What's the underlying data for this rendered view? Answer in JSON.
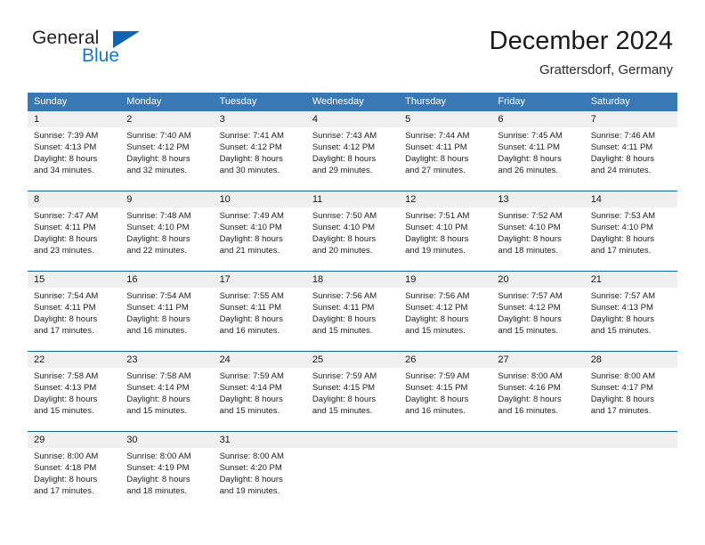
{
  "brand": {
    "name_part1": "General",
    "name_part2": "Blue",
    "triangle_color": "#1263ad"
  },
  "header": {
    "title": "December 2024",
    "subtitle": "Grattersdorf, Germany"
  },
  "theme": {
    "header_bg": "#3878b4",
    "week_divider": "#1263ad",
    "daynum_band": "#efefef"
  },
  "weekdays": [
    "Sunday",
    "Monday",
    "Tuesday",
    "Wednesday",
    "Thursday",
    "Friday",
    "Saturday"
  ],
  "weeks": [
    {
      "days": [
        {
          "num": "1",
          "sunrise": "Sunrise: 7:39 AM",
          "sunset": "Sunset: 4:13 PM",
          "daylight1": "Daylight: 8 hours",
          "daylight2": "and 34 minutes."
        },
        {
          "num": "2",
          "sunrise": "Sunrise: 7:40 AM",
          "sunset": "Sunset: 4:12 PM",
          "daylight1": "Daylight: 8 hours",
          "daylight2": "and 32 minutes."
        },
        {
          "num": "3",
          "sunrise": "Sunrise: 7:41 AM",
          "sunset": "Sunset: 4:12 PM",
          "daylight1": "Daylight: 8 hours",
          "daylight2": "and 30 minutes."
        },
        {
          "num": "4",
          "sunrise": "Sunrise: 7:43 AM",
          "sunset": "Sunset: 4:12 PM",
          "daylight1": "Daylight: 8 hours",
          "daylight2": "and 29 minutes."
        },
        {
          "num": "5",
          "sunrise": "Sunrise: 7:44 AM",
          "sunset": "Sunset: 4:11 PM",
          "daylight1": "Daylight: 8 hours",
          "daylight2": "and 27 minutes."
        },
        {
          "num": "6",
          "sunrise": "Sunrise: 7:45 AM",
          "sunset": "Sunset: 4:11 PM",
          "daylight1": "Daylight: 8 hours",
          "daylight2": "and 26 minutes."
        },
        {
          "num": "7",
          "sunrise": "Sunrise: 7:46 AM",
          "sunset": "Sunset: 4:11 PM",
          "daylight1": "Daylight: 8 hours",
          "daylight2": "and 24 minutes."
        }
      ]
    },
    {
      "days": [
        {
          "num": "8",
          "sunrise": "Sunrise: 7:47 AM",
          "sunset": "Sunset: 4:11 PM",
          "daylight1": "Daylight: 8 hours",
          "daylight2": "and 23 minutes."
        },
        {
          "num": "9",
          "sunrise": "Sunrise: 7:48 AM",
          "sunset": "Sunset: 4:10 PM",
          "daylight1": "Daylight: 8 hours",
          "daylight2": "and 22 minutes."
        },
        {
          "num": "10",
          "sunrise": "Sunrise: 7:49 AM",
          "sunset": "Sunset: 4:10 PM",
          "daylight1": "Daylight: 8 hours",
          "daylight2": "and 21 minutes."
        },
        {
          "num": "11",
          "sunrise": "Sunrise: 7:50 AM",
          "sunset": "Sunset: 4:10 PM",
          "daylight1": "Daylight: 8 hours",
          "daylight2": "and 20 minutes."
        },
        {
          "num": "12",
          "sunrise": "Sunrise: 7:51 AM",
          "sunset": "Sunset: 4:10 PM",
          "daylight1": "Daylight: 8 hours",
          "daylight2": "and 19 minutes."
        },
        {
          "num": "13",
          "sunrise": "Sunrise: 7:52 AM",
          "sunset": "Sunset: 4:10 PM",
          "daylight1": "Daylight: 8 hours",
          "daylight2": "and 18 minutes."
        },
        {
          "num": "14",
          "sunrise": "Sunrise: 7:53 AM",
          "sunset": "Sunset: 4:10 PM",
          "daylight1": "Daylight: 8 hours",
          "daylight2": "and 17 minutes."
        }
      ]
    },
    {
      "days": [
        {
          "num": "15",
          "sunrise": "Sunrise: 7:54 AM",
          "sunset": "Sunset: 4:11 PM",
          "daylight1": "Daylight: 8 hours",
          "daylight2": "and 17 minutes."
        },
        {
          "num": "16",
          "sunrise": "Sunrise: 7:54 AM",
          "sunset": "Sunset: 4:11 PM",
          "daylight1": "Daylight: 8 hours",
          "daylight2": "and 16 minutes."
        },
        {
          "num": "17",
          "sunrise": "Sunrise: 7:55 AM",
          "sunset": "Sunset: 4:11 PM",
          "daylight1": "Daylight: 8 hours",
          "daylight2": "and 16 minutes."
        },
        {
          "num": "18",
          "sunrise": "Sunrise: 7:56 AM",
          "sunset": "Sunset: 4:11 PM",
          "daylight1": "Daylight: 8 hours",
          "daylight2": "and 15 minutes."
        },
        {
          "num": "19",
          "sunrise": "Sunrise: 7:56 AM",
          "sunset": "Sunset: 4:12 PM",
          "daylight1": "Daylight: 8 hours",
          "daylight2": "and 15 minutes."
        },
        {
          "num": "20",
          "sunrise": "Sunrise: 7:57 AM",
          "sunset": "Sunset: 4:12 PM",
          "daylight1": "Daylight: 8 hours",
          "daylight2": "and 15 minutes."
        },
        {
          "num": "21",
          "sunrise": "Sunrise: 7:57 AM",
          "sunset": "Sunset: 4:13 PM",
          "daylight1": "Daylight: 8 hours",
          "daylight2": "and 15 minutes."
        }
      ]
    },
    {
      "days": [
        {
          "num": "22",
          "sunrise": "Sunrise: 7:58 AM",
          "sunset": "Sunset: 4:13 PM",
          "daylight1": "Daylight: 8 hours",
          "daylight2": "and 15 minutes."
        },
        {
          "num": "23",
          "sunrise": "Sunrise: 7:58 AM",
          "sunset": "Sunset: 4:14 PM",
          "daylight1": "Daylight: 8 hours",
          "daylight2": "and 15 minutes."
        },
        {
          "num": "24",
          "sunrise": "Sunrise: 7:59 AM",
          "sunset": "Sunset: 4:14 PM",
          "daylight1": "Daylight: 8 hours",
          "daylight2": "and 15 minutes."
        },
        {
          "num": "25",
          "sunrise": "Sunrise: 7:59 AM",
          "sunset": "Sunset: 4:15 PM",
          "daylight1": "Daylight: 8 hours",
          "daylight2": "and 15 minutes."
        },
        {
          "num": "26",
          "sunrise": "Sunrise: 7:59 AM",
          "sunset": "Sunset: 4:15 PM",
          "daylight1": "Daylight: 8 hours",
          "daylight2": "and 16 minutes."
        },
        {
          "num": "27",
          "sunrise": "Sunrise: 8:00 AM",
          "sunset": "Sunset: 4:16 PM",
          "daylight1": "Daylight: 8 hours",
          "daylight2": "and 16 minutes."
        },
        {
          "num": "28",
          "sunrise": "Sunrise: 8:00 AM",
          "sunset": "Sunset: 4:17 PM",
          "daylight1": "Daylight: 8 hours",
          "daylight2": "and 17 minutes."
        }
      ]
    },
    {
      "days": [
        {
          "num": "29",
          "sunrise": "Sunrise: 8:00 AM",
          "sunset": "Sunset: 4:18 PM",
          "daylight1": "Daylight: 8 hours",
          "daylight2": "and 17 minutes."
        },
        {
          "num": "30",
          "sunrise": "Sunrise: 8:00 AM",
          "sunset": "Sunset: 4:19 PM",
          "daylight1": "Daylight: 8 hours",
          "daylight2": "and 18 minutes."
        },
        {
          "num": "31",
          "sunrise": "Sunrise: 8:00 AM",
          "sunset": "Sunset: 4:20 PM",
          "daylight1": "Daylight: 8 hours",
          "daylight2": "and 19 minutes."
        },
        {
          "num": "",
          "sunrise": "",
          "sunset": "",
          "daylight1": "",
          "daylight2": ""
        },
        {
          "num": "",
          "sunrise": "",
          "sunset": "",
          "daylight1": "",
          "daylight2": ""
        },
        {
          "num": "",
          "sunrise": "",
          "sunset": "",
          "daylight1": "",
          "daylight2": ""
        },
        {
          "num": "",
          "sunrise": "",
          "sunset": "",
          "daylight1": "",
          "daylight2": ""
        }
      ]
    }
  ]
}
